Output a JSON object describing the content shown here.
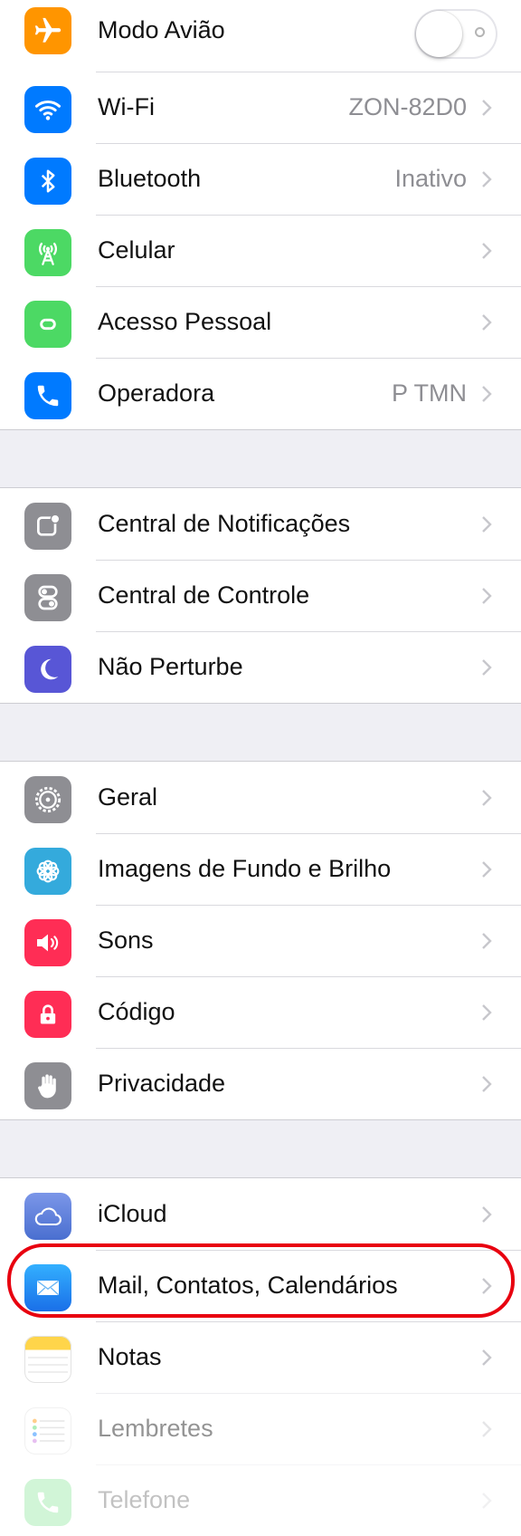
{
  "colors": {
    "airplane": "#ff9500",
    "wifi": "#007aff",
    "bluetooth": "#007aff",
    "cellular": "#4cd964",
    "hotspot": "#4cd964",
    "carrier": "#007aff",
    "notifications": "#8e8e93",
    "control_center": "#8e8e93",
    "dnd": "#5856d6",
    "general": "#8e8e93",
    "wallpaper": "#34aadc",
    "sounds": "#ff2d55",
    "passcode": "#ff2d55",
    "privacy": "#8e8e93",
    "icloud": "#5a7bd6",
    "mail": "#1e90ff",
    "notes": "#ffcc00",
    "highlight": "#e8000f"
  },
  "group1": {
    "airplane": {
      "label": "Modo Avião",
      "icon": "airplane-icon",
      "toggle_on": false
    },
    "wifi": {
      "label": "Wi-Fi",
      "value": "ZON-82D0",
      "icon": "wifi-icon"
    },
    "bluetooth": {
      "label": "Bluetooth",
      "value": "Inativo",
      "icon": "bluetooth-icon"
    },
    "cellular": {
      "label": "Celular",
      "icon": "cellular-antenna-icon"
    },
    "hotspot": {
      "label": "Acesso Pessoal",
      "icon": "hotspot-icon"
    },
    "carrier": {
      "label": "Operadora",
      "value": "P TMN",
      "icon": "phone-icon"
    }
  },
  "group2": {
    "notifications": {
      "label": "Central de Notificações",
      "icon": "notification-center-icon"
    },
    "control_center": {
      "label": "Central de Controle",
      "icon": "control-center-icon"
    },
    "dnd": {
      "label": "Não Perturbe",
      "icon": "moon-icon"
    }
  },
  "group3": {
    "general": {
      "label": "Geral",
      "icon": "gear-icon"
    },
    "wallpaper": {
      "label": "Imagens de Fundo e Brilho",
      "icon": "flower-icon"
    },
    "sounds": {
      "label": "Sons",
      "icon": "speaker-icon"
    },
    "passcode": {
      "label": "Código",
      "icon": "lock-icon"
    },
    "privacy": {
      "label": "Privacidade",
      "icon": "hand-icon"
    }
  },
  "group4": {
    "icloud": {
      "label": "iCloud",
      "icon": "cloud-icon"
    },
    "mail": {
      "label": "Mail, Contatos, Calendários",
      "icon": "mail-icon"
    },
    "notes": {
      "label": "Notas",
      "icon": "notes-icon"
    },
    "reminders": {
      "label": "Lembretes",
      "icon": "reminders-icon"
    },
    "phone": {
      "label": "Telefone",
      "icon": "phone-app-icon"
    }
  }
}
